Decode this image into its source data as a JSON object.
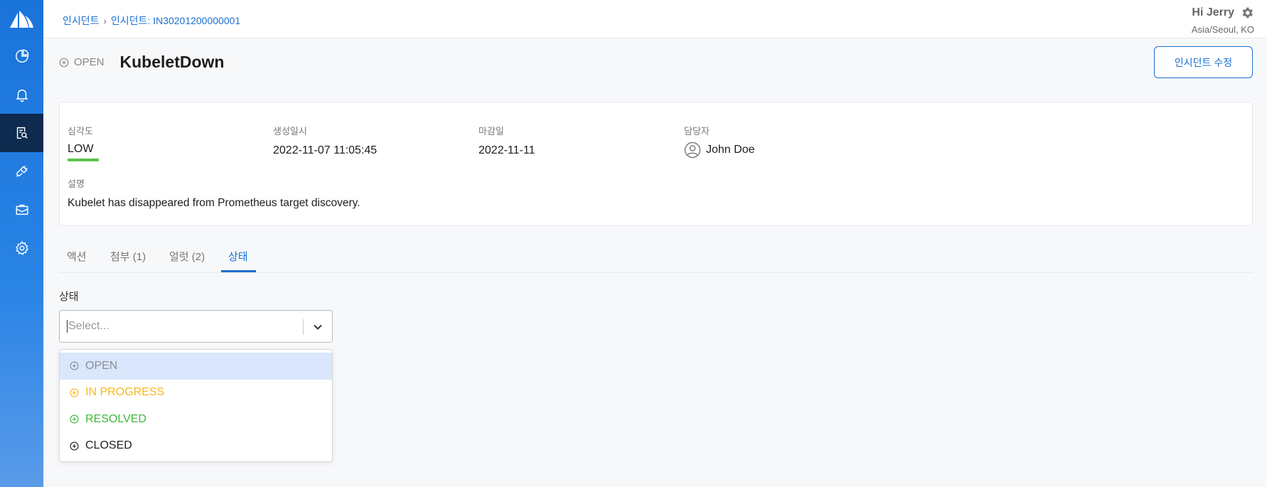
{
  "breadcrumb": {
    "root": "인시던트",
    "current": "인시던트: IN30201200000001"
  },
  "user": {
    "greeting": "Hi Jerry",
    "timezone": "Asia/Seoul, KO"
  },
  "sidebar": {
    "items": [
      {
        "icon": "dashboard-pie-icon"
      },
      {
        "icon": "bell-icon"
      },
      {
        "icon": "incident-search-icon",
        "active": true
      },
      {
        "icon": "integration-plug-icon"
      },
      {
        "icon": "inbox-icon"
      },
      {
        "icon": "settings-gear-icon"
      }
    ]
  },
  "incident": {
    "status": "OPEN",
    "title": "KubeletDown",
    "edit_button": "인시던트 수정"
  },
  "info": {
    "severity_label": "심각도",
    "severity_value": "LOW",
    "severity_color": "#5cc24a",
    "created_label": "생성일시",
    "created_value": "2022-11-07 11:05:45",
    "due_label": "마감일",
    "due_value": "2022-11-11",
    "assignee_label": "담당자",
    "assignee_value": "John Doe",
    "description_label": "설명",
    "description_value": "Kubelet has disappeared from Prometheus target discovery."
  },
  "tabs": [
    {
      "label": "액션"
    },
    {
      "label": "첨부 (1)"
    },
    {
      "label": "얼럿 (2)"
    },
    {
      "label": "상태",
      "active": true
    }
  ],
  "state_form": {
    "label": "상태",
    "placeholder": "Select...",
    "options": [
      {
        "label": "OPEN",
        "color": "#8a8f96",
        "highlighted": true
      },
      {
        "label": "IN PROGRESS",
        "color": "#f5b823"
      },
      {
        "label": "RESOLVED",
        "color": "#3fb83a"
      },
      {
        "label": "CLOSED",
        "color": "#222222"
      }
    ]
  },
  "colors": {
    "accent": "#1a6fd0",
    "sidebar_active": "#0e2a4f"
  }
}
